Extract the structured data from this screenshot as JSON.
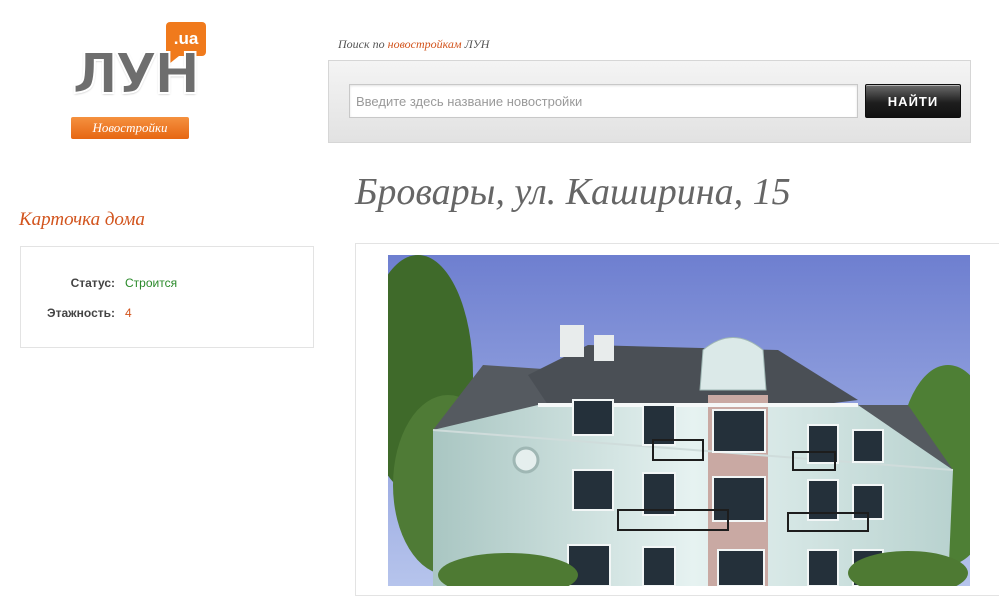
{
  "logo": {
    "domain_suffix": ".ua",
    "brand": "ЛУН",
    "tagline": "Новостройки"
  },
  "search": {
    "caption_prefix": "Поиск по ",
    "caption_link": "новостройкам",
    "caption_suffix": " ЛУН",
    "placeholder": "Введите здесь название новостройки",
    "value": "",
    "button_label": "НАЙТИ"
  },
  "page": {
    "title": "Бровары, ул. Каширина, 15"
  },
  "card": {
    "heading": "Карточка дома",
    "rows": [
      {
        "label": "Статус:",
        "value": "Строится"
      },
      {
        "label": "Этажность:",
        "value": "4"
      }
    ]
  },
  "colors": {
    "accent": "#d2541d",
    "status_green": "#2a8a2a",
    "logo_orange": "#f07a1c"
  },
  "image": {
    "subject": "building-rendering"
  }
}
